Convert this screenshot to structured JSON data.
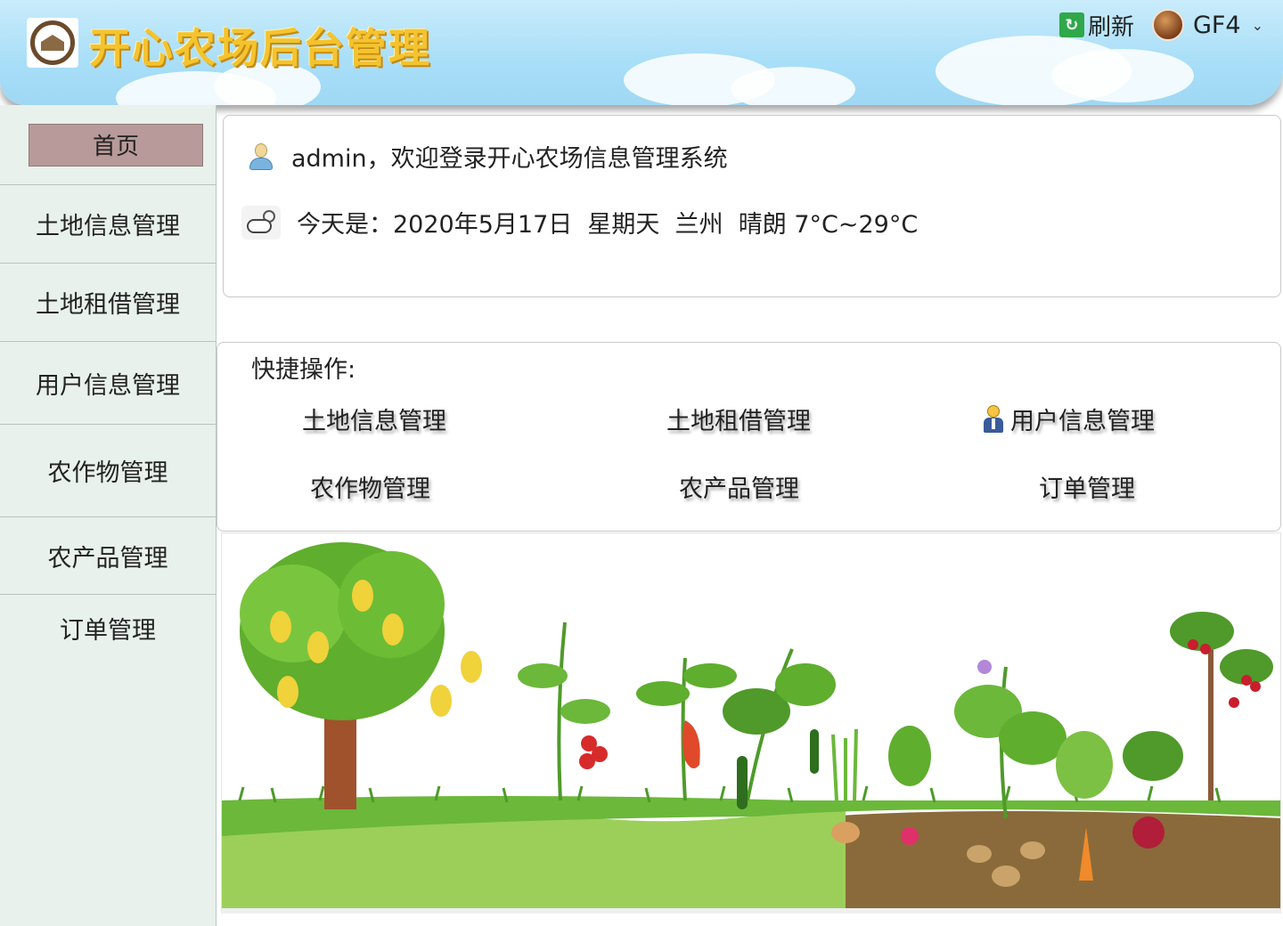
{
  "header": {
    "site_title": "开心农场后台管理",
    "refresh_label": "刷新",
    "user_name": "GF4",
    "logo_icon": "farm-logo-icon",
    "refresh_icon": "refresh-icon",
    "avatar_icon": "horse-avatar"
  },
  "sidebar": {
    "home_label": "首页",
    "items": [
      {
        "label": "土地信息管理"
      },
      {
        "label": "土地租借管理"
      },
      {
        "label": "用户信息管理"
      },
      {
        "label": "农作物管理"
      },
      {
        "label": "农产品管理"
      },
      {
        "label": "订单管理"
      }
    ]
  },
  "welcome": {
    "greeting": "admin，欢迎登录开心农场信息管理系统",
    "weather_line": "今天是：2020年5月17日  星期天  兰州  晴朗 7°C~29°C"
  },
  "quick": {
    "title": "快捷操作:",
    "items": [
      {
        "label": "土地信息管理"
      },
      {
        "label": "土地租借管理"
      },
      {
        "label": "用户信息管理"
      },
      {
        "label": "农作物管理"
      },
      {
        "label": "农产品管理"
      },
      {
        "label": "订单管理"
      }
    ]
  },
  "colors": {
    "header_sky": "#a8def8",
    "title_gold": "#f4c32f",
    "sidebar_bg": "#e8f1ec",
    "home_button": "#b79a99"
  }
}
